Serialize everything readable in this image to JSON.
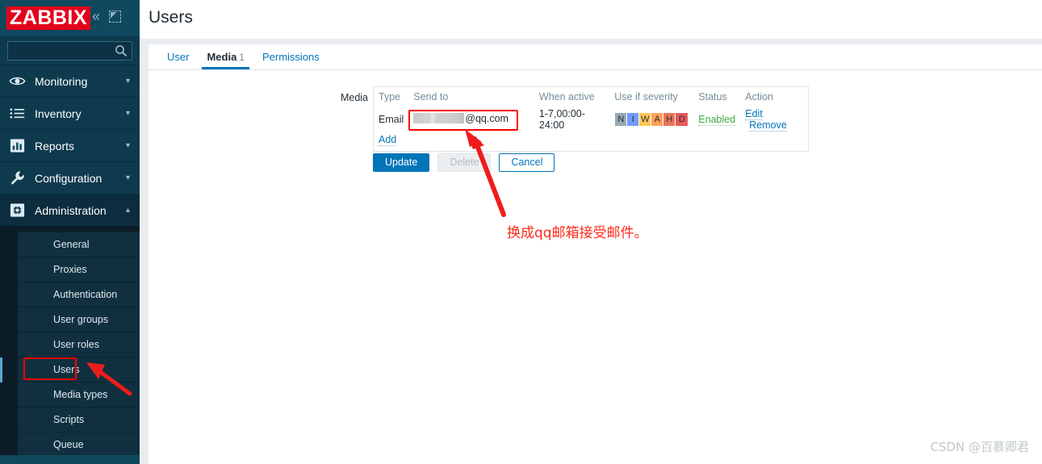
{
  "brand": {
    "logo_text": "ZABBIX",
    "logo_bg": "#e3001b",
    "sidebar_bg": "#0f3a4d"
  },
  "sidebar": {
    "search": {
      "value": "",
      "placeholder": "",
      "icon": "search-icon"
    },
    "collapse_icon": "chevron-double-left-icon",
    "expand_icon": "expand-icon",
    "items": [
      {
        "label": "Monitoring",
        "icon": "eye-icon",
        "chevron": "chevron-down-icon",
        "active": false
      },
      {
        "label": "Inventory",
        "icon": "list-icon",
        "chevron": "chevron-down-icon",
        "active": false
      },
      {
        "label": "Reports",
        "icon": "chart-icon",
        "chevron": "chevron-down-icon",
        "active": false
      },
      {
        "label": "Configuration",
        "icon": "wrench-icon",
        "chevron": "chevron-down-icon",
        "active": false
      },
      {
        "label": "Administration",
        "icon": "gear-icon",
        "chevron": "chevron-up-icon",
        "active": true
      }
    ],
    "submenu": [
      {
        "label": "General",
        "current": false
      },
      {
        "label": "Proxies",
        "current": false
      },
      {
        "label": "Authentication",
        "current": false
      },
      {
        "label": "User groups",
        "current": false
      },
      {
        "label": "User roles",
        "current": false
      },
      {
        "label": "Users",
        "current": true
      },
      {
        "label": "Media types",
        "current": false
      },
      {
        "label": "Scripts",
        "current": false
      },
      {
        "label": "Queue",
        "current": false
      }
    ]
  },
  "header": {
    "title": "Users"
  },
  "tabs": [
    {
      "label": "User",
      "count": "",
      "active": false
    },
    {
      "label": "Media",
      "count": "1",
      "active": true
    },
    {
      "label": "Permissions",
      "count": "",
      "active": false
    }
  ],
  "media_form": {
    "label": "Media",
    "columns": {
      "type": "Type",
      "send_to": "Send to",
      "when_active": "When active",
      "use_if_severity": "Use if severity",
      "status": "Status",
      "action": "Action"
    },
    "rows": [
      {
        "type": "Email",
        "send_to_redacted": true,
        "send_to_suffix": "@qq.com",
        "when_active": "1-7,00:00-24:00",
        "severities": [
          {
            "letter": "N",
            "name": "Not classified",
            "color": "#97aab3"
          },
          {
            "letter": "I",
            "name": "Information",
            "color": "#7499ff"
          },
          {
            "letter": "W",
            "name": "Warning",
            "color": "#ffc859"
          },
          {
            "letter": "A",
            "name": "Average",
            "color": "#ffa059"
          },
          {
            "letter": "H",
            "name": "High",
            "color": "#e97659"
          },
          {
            "letter": "D",
            "name": "Disaster",
            "color": "#e45959"
          }
        ],
        "status": "Enabled",
        "status_color": "#3daa3d",
        "actions": [
          "Edit",
          "Remove"
        ]
      }
    ],
    "add_label": "Add"
  },
  "buttons": {
    "update": "Update",
    "delete": "Delete",
    "cancel": "Cancel",
    "primary_color": "#0275b8"
  },
  "annotations": {
    "note_text": "换成qq邮箱接受邮件。",
    "note_color": "#ff2a17",
    "highlight_color": "#ff0000",
    "arrows": 2
  },
  "watermark": {
    "text": "CSDN @百慕卿君"
  }
}
